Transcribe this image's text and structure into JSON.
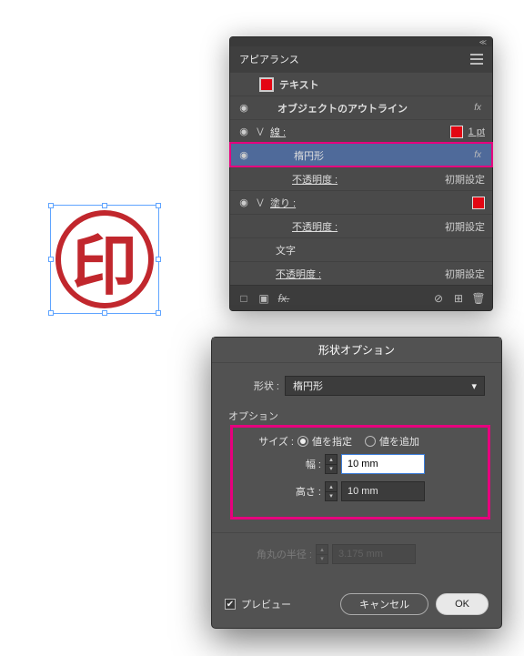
{
  "seal": {
    "char": "印"
  },
  "appearance_panel": {
    "title": "アピアランス",
    "rows": {
      "text_label": "テキスト",
      "object_outline": "オブジェクトのアウトライン",
      "stroke_label": "線 :",
      "stroke_value": "1 pt",
      "ellipse": "楕円形",
      "opacity_label": "不透明度 :",
      "opacity_value": "初期設定",
      "fill_label": "塗り :",
      "char_label": "文字"
    },
    "fx": "fx",
    "fx_strike": "fx."
  },
  "shape_dialog": {
    "title": "形状オプション",
    "shape_label": "形状 :",
    "shape_value": "楕円形",
    "options_label": "オプション",
    "size_label": "サイズ :",
    "size_radio_abs": "値を指定",
    "size_radio_rel": "値を追加",
    "width_label": "幅 :",
    "width_value": "10 mm",
    "height_label": "高さ :",
    "height_value": "10 mm",
    "corner_label": "角丸の半径 :",
    "corner_value": "3.175 mm",
    "preview_label": "プレビュー",
    "cancel": "キャンセル",
    "ok": "OK"
  }
}
